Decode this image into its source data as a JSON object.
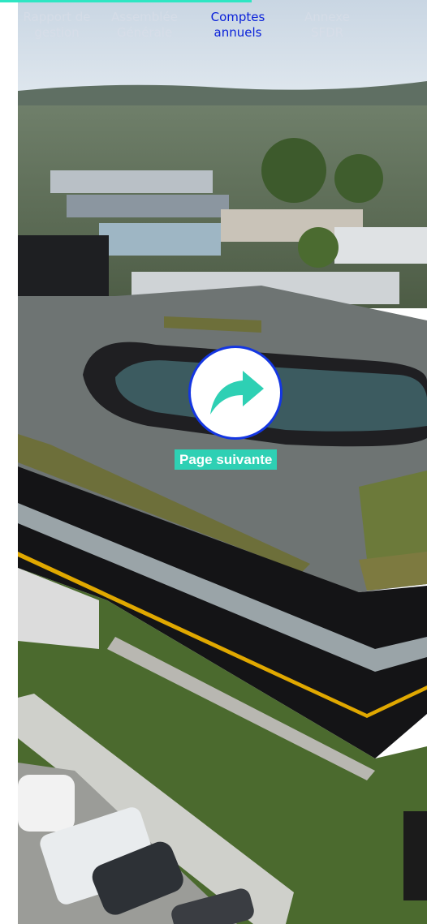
{
  "nav": {
    "tabs": [
      {
        "label_line1": "Rapport de",
        "label_line2": "gestion",
        "active": false
      },
      {
        "label_line1": "Assemblée",
        "label_line2": "Générale",
        "active": false
      },
      {
        "label_line1": "Comptes",
        "label_line2": "annuels",
        "active": true
      },
      {
        "label_line1": "Annexe",
        "label_line2": "SFDR",
        "active": false
      }
    ]
  },
  "next_page": {
    "label": "Page suivante",
    "icon": "curved-arrow-right-icon"
  },
  "colors": {
    "active_tab": "#0a21d9",
    "accent": "#2ee6c3",
    "button_border": "#1436e2",
    "label_bg": "#2ed0b4"
  }
}
